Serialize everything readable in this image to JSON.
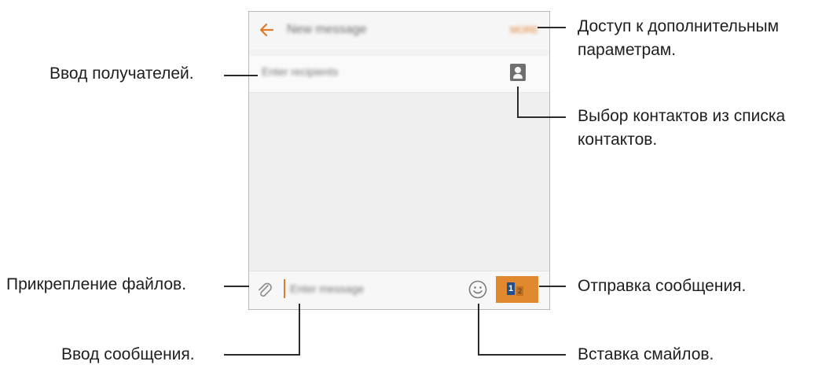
{
  "app": {
    "title": "New message",
    "more_label": "MORE",
    "recipient_placeholder": "Enter recipients",
    "message_placeholder": "Enter message",
    "send_sim_primary": "1",
    "send_sim_secondary": "2"
  },
  "annotations": {
    "recipients": "Ввод получателей.",
    "more_options_line1": "Доступ к дополнительным",
    "more_options_line2": "параметрам.",
    "contacts_line1": "Выбор контактов из списка",
    "contacts_line2": "контактов.",
    "attach": "Прикрепление файлов.",
    "send": "Отправка сообщения.",
    "message_input": "Ввод сообщения.",
    "emoji": "Вставка смайлов."
  },
  "colors": {
    "accent": "#e07b2a",
    "send_button": "#e0892e",
    "sim_blue": "#1f4f8e"
  }
}
